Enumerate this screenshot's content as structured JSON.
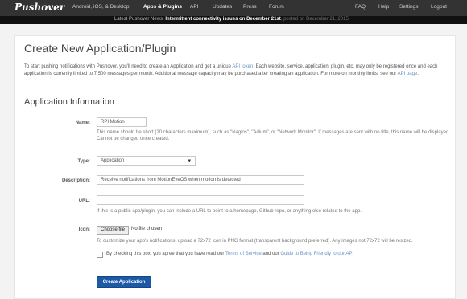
{
  "header": {
    "logo": "Pushover",
    "nav": [
      "Android, iOS, & Desktop",
      "Apps & Plugins",
      "API",
      "Updates",
      "Press",
      "Forum"
    ],
    "right_nav": [
      "FAQ",
      "Help",
      "Settings",
      "Logout"
    ],
    "news_prefix": "Latest Pushover News:",
    "news_headline": "Intermittent connectivity issues on December 21st",
    "news_date": ", posted on December 21, 2015"
  },
  "page": {
    "title": "Create New Application/Plugin",
    "intro": {
      "p1": "To start pushing notifications with Pushover, you'll need to create an Application and get a unique ",
      "link_api_token": "API token",
      "p2": ". Each website, service, application, plugin, etc. may only be registered once and each application is currently limited to 7,500 messages per month. Additional message capacity may be purchased after creating an application. For more on monthly limits, see our ",
      "link_api_page": "API page",
      "p3": "."
    },
    "section_title": "Application Information"
  },
  "form": {
    "name_label": "Name:",
    "name_value": "RPI Motion",
    "name_hint": "This name should be short (20 characters maximum), such as \"Nagios\", \"Adium\", or \"Network Monitor\". If messages are sent with no title, this name will be displayed. Cannot be changed once created.",
    "type_label": "Type:",
    "type_value": "Application",
    "description_label": "Description:",
    "description_value": "Receive notifications from MotionEyeOS when motion is detected",
    "url_label": "URL:",
    "url_value": "",
    "url_hint": "If this is a public app/plugin, you can include a URL to point to a homepage, Github repo, or anything else related to the app.",
    "icon_label": "Icon:",
    "choose_file": "Choose file",
    "no_file": "No file chosen",
    "icon_hint": "To customize your app's notifications, upload a 72x72 icon in PNG format (transparent background preferred). Any images not 72x72 will be resized.",
    "agree_p1": "By checking this box, you agree that you have read our ",
    "agree_tos": "Terms of Service",
    "agree_p2": " and our ",
    "agree_guide": "Guide to Being Friendly to our API",
    "submit": "Create Application"
  }
}
